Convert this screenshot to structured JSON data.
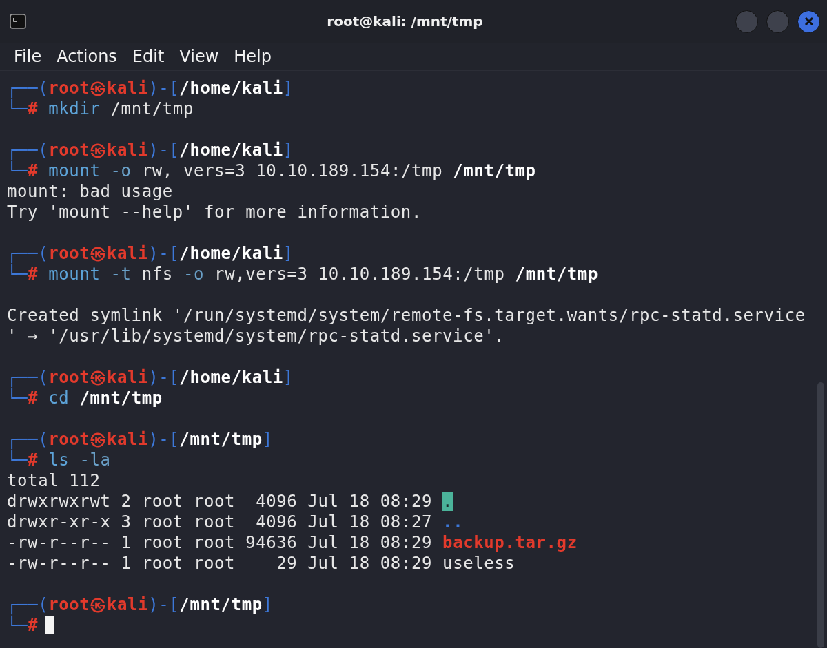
{
  "window": {
    "title": "root@kali: /mnt/tmp"
  },
  "menu": [
    {
      "label": "File"
    },
    {
      "label": "Actions"
    },
    {
      "label": "Edit"
    },
    {
      "label": "View"
    },
    {
      "label": "Help"
    }
  ],
  "terminal": {
    "lines": [
      {
        "kind": "prompt",
        "corner": "┌──",
        "open": "(",
        "user": "root",
        "at": "㉿",
        "host": "kali",
        "close": ")-[",
        "path": "/home/kali",
        "end": "]"
      },
      {
        "kind": "command",
        "corner": "└─",
        "hash": "#",
        "command": "mkdir",
        "args": [
          {
            "kind": "word",
            "text": "/mnt/tmp"
          }
        ]
      },
      {
        "kind": "blank"
      },
      {
        "kind": "prompt",
        "corner": "┌──",
        "open": "(",
        "user": "root",
        "at": "㉿",
        "host": "kali",
        "close": ")-[",
        "path": "/home/kali",
        "end": "]"
      },
      {
        "kind": "command",
        "corner": "└─",
        "hash": "#",
        "command": "mount",
        "args": [
          {
            "kind": "option",
            "text": "-o"
          },
          {
            "kind": "word",
            "text": "rw,"
          },
          {
            "kind": "word",
            "text": "vers=3"
          },
          {
            "kind": "word",
            "text": "10.10.189.154:/tmp"
          },
          {
            "kind": "path",
            "text": "/mnt/tmp"
          }
        ]
      },
      {
        "kind": "output",
        "text": "mount: bad usage"
      },
      {
        "kind": "output",
        "text": "Try 'mount --help' for more information."
      },
      {
        "kind": "blank"
      },
      {
        "kind": "prompt",
        "corner": "┌──",
        "open": "(",
        "user": "root",
        "at": "㉿",
        "host": "kali",
        "close": ")-[",
        "path": "/home/kali",
        "end": "]"
      },
      {
        "kind": "command",
        "corner": "└─",
        "hash": "#",
        "command": "mount",
        "args": [
          {
            "kind": "option",
            "text": "-t"
          },
          {
            "kind": "word",
            "text": "nfs"
          },
          {
            "kind": "option",
            "text": "-o"
          },
          {
            "kind": "word",
            "text": "rw,vers=3"
          },
          {
            "kind": "word",
            "text": "10.10.189.154:/tmp"
          },
          {
            "kind": "path",
            "text": "/mnt/tmp"
          }
        ]
      },
      {
        "kind": "blank"
      },
      {
        "kind": "output",
        "text": "Created symlink '/run/systemd/system/remote-fs.target.wants/rpc-statd.service"
      },
      {
        "kind": "output",
        "text": "' → '/usr/lib/systemd/system/rpc-statd.service'."
      },
      {
        "kind": "blank"
      },
      {
        "kind": "prompt",
        "corner": "┌──",
        "open": "(",
        "user": "root",
        "at": "㉿",
        "host": "kali",
        "close": ")-[",
        "path": "/home/kali",
        "end": "]"
      },
      {
        "kind": "command",
        "corner": "└─",
        "hash": "#",
        "command": "cd",
        "args": [
          {
            "kind": "path",
            "text": "/mnt/tmp"
          }
        ]
      },
      {
        "kind": "blank"
      },
      {
        "kind": "prompt",
        "corner": "┌──",
        "open": "(",
        "user": "root",
        "at": "㉿",
        "host": "kali",
        "close": ")-[",
        "path": "/mnt/tmp",
        "end": "]"
      },
      {
        "kind": "command",
        "corner": "└─",
        "hash": "#",
        "command": "ls",
        "args": [
          {
            "kind": "option",
            "text": "-la"
          }
        ]
      },
      {
        "kind": "output",
        "text": "total 112"
      },
      {
        "kind": "listing",
        "meta": "drwxrwxrwt 2 root root  4096 Jul 18 08:29",
        "file": {
          "kind": "sticky",
          "name": "."
        }
      },
      {
        "kind": "listing",
        "meta": "drwxr-xr-x 3 root root  4096 Jul 18 08:27",
        "file": {
          "kind": "directory",
          "name": ".."
        }
      },
      {
        "kind": "listing",
        "meta": "-rw-r--r-- 1 root root 94636 Jul 18 08:29",
        "file": {
          "kind": "archive",
          "name": "backup.tar.gz"
        }
      },
      {
        "kind": "listing",
        "meta": "-rw-r--r-- 1 root root    29 Jul 18 08:29",
        "file": {
          "kind": "regular",
          "name": "useless"
        }
      },
      {
        "kind": "blank"
      },
      {
        "kind": "prompt",
        "corner": "┌──",
        "open": "(",
        "user": "root",
        "at": "㉿",
        "host": "kali",
        "close": ")-[",
        "path": "/mnt/tmp",
        "end": "]"
      },
      {
        "kind": "input",
        "corner": "└─",
        "hash": "#",
        "cursor": true
      }
    ]
  }
}
